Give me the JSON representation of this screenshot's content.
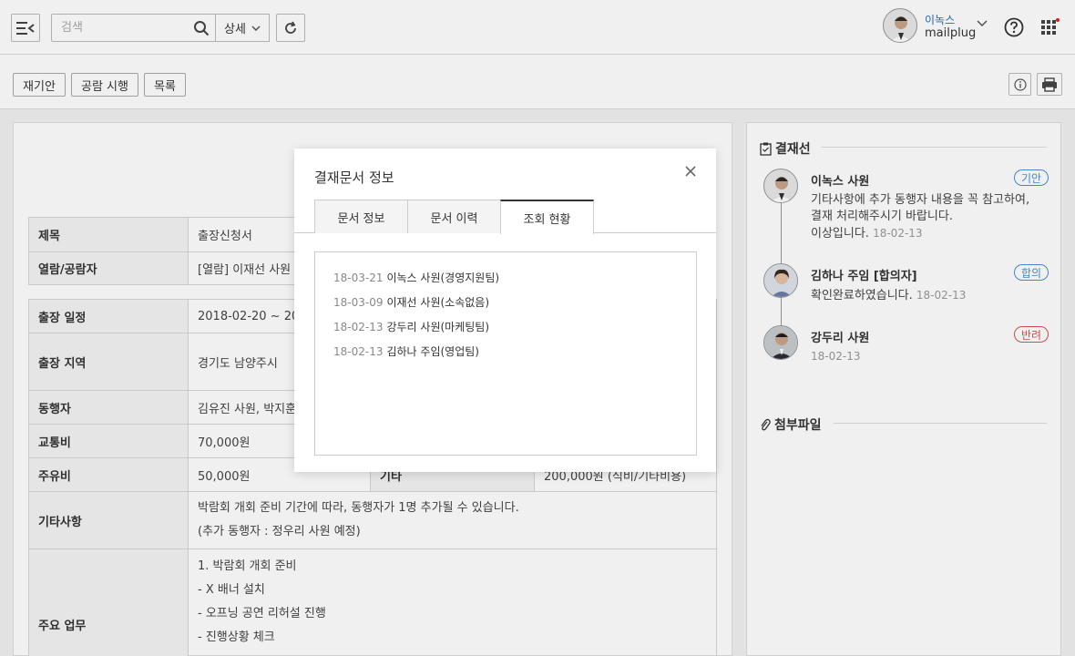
{
  "header": {
    "search_placeholder": "검색",
    "detail_label": "상세",
    "user_name": "이녹스",
    "user_org": "mailplug"
  },
  "toolbar": {
    "resubmit": "재기안",
    "circulate": "공람 시행",
    "list": "목록"
  },
  "document": {
    "rows1": [
      {
        "label": "제목",
        "value": "출장신청서"
      },
      {
        "label": "열람/공람자",
        "value": "[열람] 이재선 사원 ("
      }
    ],
    "rows2": [
      {
        "label": "출장 일정",
        "value": "2018-02-20 ~ 2018"
      },
      {
        "label": "출장 지역",
        "value": "경기도 남양주시"
      },
      {
        "label": "동행자",
        "value": "김유진 사원, 박지훈"
      },
      {
        "label": "교통비",
        "value": "70,000원"
      },
      {
        "label": "주유비",
        "value": "50,000원",
        "label2": "기타",
        "value2": "200,000원 (식비/기타비용)"
      },
      {
        "label": "기타사항",
        "value_lines": [
          "박람회 개회 준비 기간에 따라, 동행자가 1명 추가될 수 있습니다.",
          "(추가 동행자 : 정우리 사원 예정)"
        ]
      },
      {
        "label": "주요 업무",
        "value_lines": [
          "1. 박람회 개회 준비",
          "- X 배너 설치",
          "- 오프닝 공연 리허설 진행",
          "- 진행상황 체크"
        ]
      }
    ]
  },
  "approval": {
    "title": "결재선",
    "items": [
      {
        "name": "이녹스 사원",
        "badge": "기안",
        "badge_color": "#4a90d9",
        "text": [
          "기타사항에 추가 동행자 내용을 꼭 참고하여,",
          "결재 처리해주시기 바랍니다.",
          "이상입니다."
        ],
        "date": "18-02-13"
      },
      {
        "name": "김하나 주임 [합의자]",
        "badge": "합의",
        "badge_color": "#4a90d9",
        "text": [
          "확인완료하였습니다."
        ],
        "date": "18-02-13"
      },
      {
        "name": "강두리 사원",
        "badge": "반려",
        "badge_color": "#d9534f",
        "text": [],
        "date": "18-02-13"
      }
    ]
  },
  "attachments": {
    "title": "첨부파일"
  },
  "modal": {
    "title": "결재문서 정보",
    "tabs": [
      "문서 정보",
      "문서 이력",
      "조회 현황"
    ],
    "active_tab": 2,
    "views": [
      {
        "date": "18-03-21",
        "who": "이녹스 사원(경영지원팀)"
      },
      {
        "date": "18-03-09",
        "who": "이재선 사원(소속없음)"
      },
      {
        "date": "18-02-13",
        "who": "강두리 사원(마케팅팀)"
      },
      {
        "date": "18-02-13",
        "who": "김하나 주임(영업팀)"
      }
    ]
  }
}
